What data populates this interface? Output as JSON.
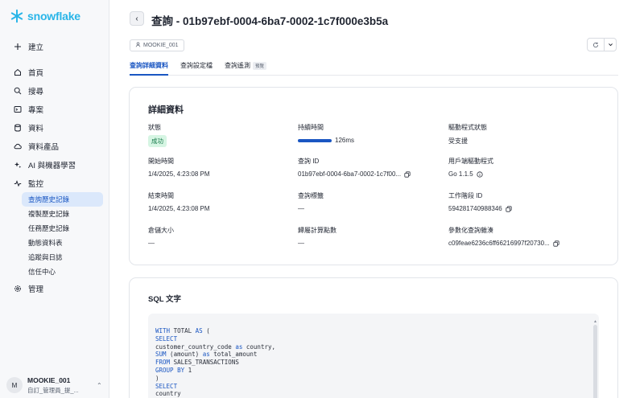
{
  "brand": {
    "name": "snowflake",
    "color": "#29b5e8"
  },
  "sidebar": {
    "create_label": "建立",
    "items": [
      {
        "label": "首頁",
        "icon": "home-icon"
      },
      {
        "label": "搜尋",
        "icon": "search-icon"
      },
      {
        "label": "專案",
        "icon": "projects-icon"
      },
      {
        "label": "資料",
        "icon": "database-icon"
      },
      {
        "label": "資料產品",
        "icon": "cloud-icon"
      },
      {
        "label": "AI 與機器學習",
        "icon": "sparkle-icon"
      },
      {
        "label": "監控",
        "icon": "activity-icon"
      }
    ],
    "sub_items": [
      "查詢歷史記錄",
      "複製歷史記錄",
      "任務歷史記錄",
      "動態資料表",
      "追蹤與日誌",
      "信任中心"
    ],
    "admin_label": "管理",
    "user": {
      "initial": "M",
      "name": "MOOKIE_001",
      "role": "自訂_管理員_提_..."
    }
  },
  "header": {
    "title": "查詢 - 01b97ebf-0004-6ba7-0002-1c7f000e3b5a",
    "user_chip": "MOOKIE_001"
  },
  "tabs": [
    {
      "label": "查詢詳細資料",
      "active": true
    },
    {
      "label": "查詢設定檔",
      "active": false
    },
    {
      "label": "查詢遙測",
      "active": false,
      "badge": "預覽"
    }
  ],
  "details": {
    "title": "詳細資料",
    "status_label": "狀態",
    "status_value": "成功",
    "duration_label": "持續時間",
    "duration_value": "126ms",
    "duration_fraction": 1.0,
    "driver_status_label": "驅動程式狀態",
    "driver_status_value": "受支援",
    "start_label": "開始時間",
    "start_value": "1/4/2025, 4:23:08 PM",
    "query_id_label": "查詢 ID",
    "query_id_value": "01b97ebf-0004-6ba7-0002-1c7f00...",
    "client_driver_label": "用戶端驅動程式",
    "client_driver_value": "Go 1.1.5",
    "end_label": "結束時間",
    "end_value": "1/4/2025, 4:23:08 PM",
    "query_tag_label": "查詢標籤",
    "query_tag_value": "—",
    "session_id_label": "工作階段 ID",
    "session_id_value": "594281740988346",
    "warehouse_size_label": "倉儲大小",
    "warehouse_size_value": "—",
    "credits_label": "歸屬計算點數",
    "credits_value": "—",
    "param_hash_label": "參數化查詢雜湊",
    "param_hash_value": "c09feae6236c6ff66216997f20730..."
  },
  "sql": {
    "title": "SQL 文字",
    "lines": [
      [
        [
          "kw",
          "WITH"
        ],
        [
          "",
          "TOTAL"
        ],
        [
          "kw",
          "AS"
        ],
        [
          "",
          "("
        ]
      ],
      [
        [
          "kw",
          "SELECT"
        ]
      ],
      [
        [
          "",
          "customer_country_code"
        ],
        [
          "kw",
          "as"
        ],
        [
          "",
          "country,"
        ]
      ],
      [
        [
          "kw",
          "SUM"
        ],
        [
          "",
          "(amount)"
        ],
        [
          "kw",
          "as"
        ],
        [
          "",
          "total_amount"
        ]
      ],
      [
        [
          "kw",
          "FROM"
        ],
        [
          "",
          "SALES_TRANSACTIONS"
        ]
      ],
      [
        [
          "kw",
          "GROUP BY"
        ],
        [
          "",
          "1"
        ]
      ],
      [
        [
          "",
          ")"
        ]
      ],
      [
        [
          "kw",
          "SELECT"
        ]
      ],
      [
        [
          "",
          "country"
        ]
      ]
    ]
  }
}
